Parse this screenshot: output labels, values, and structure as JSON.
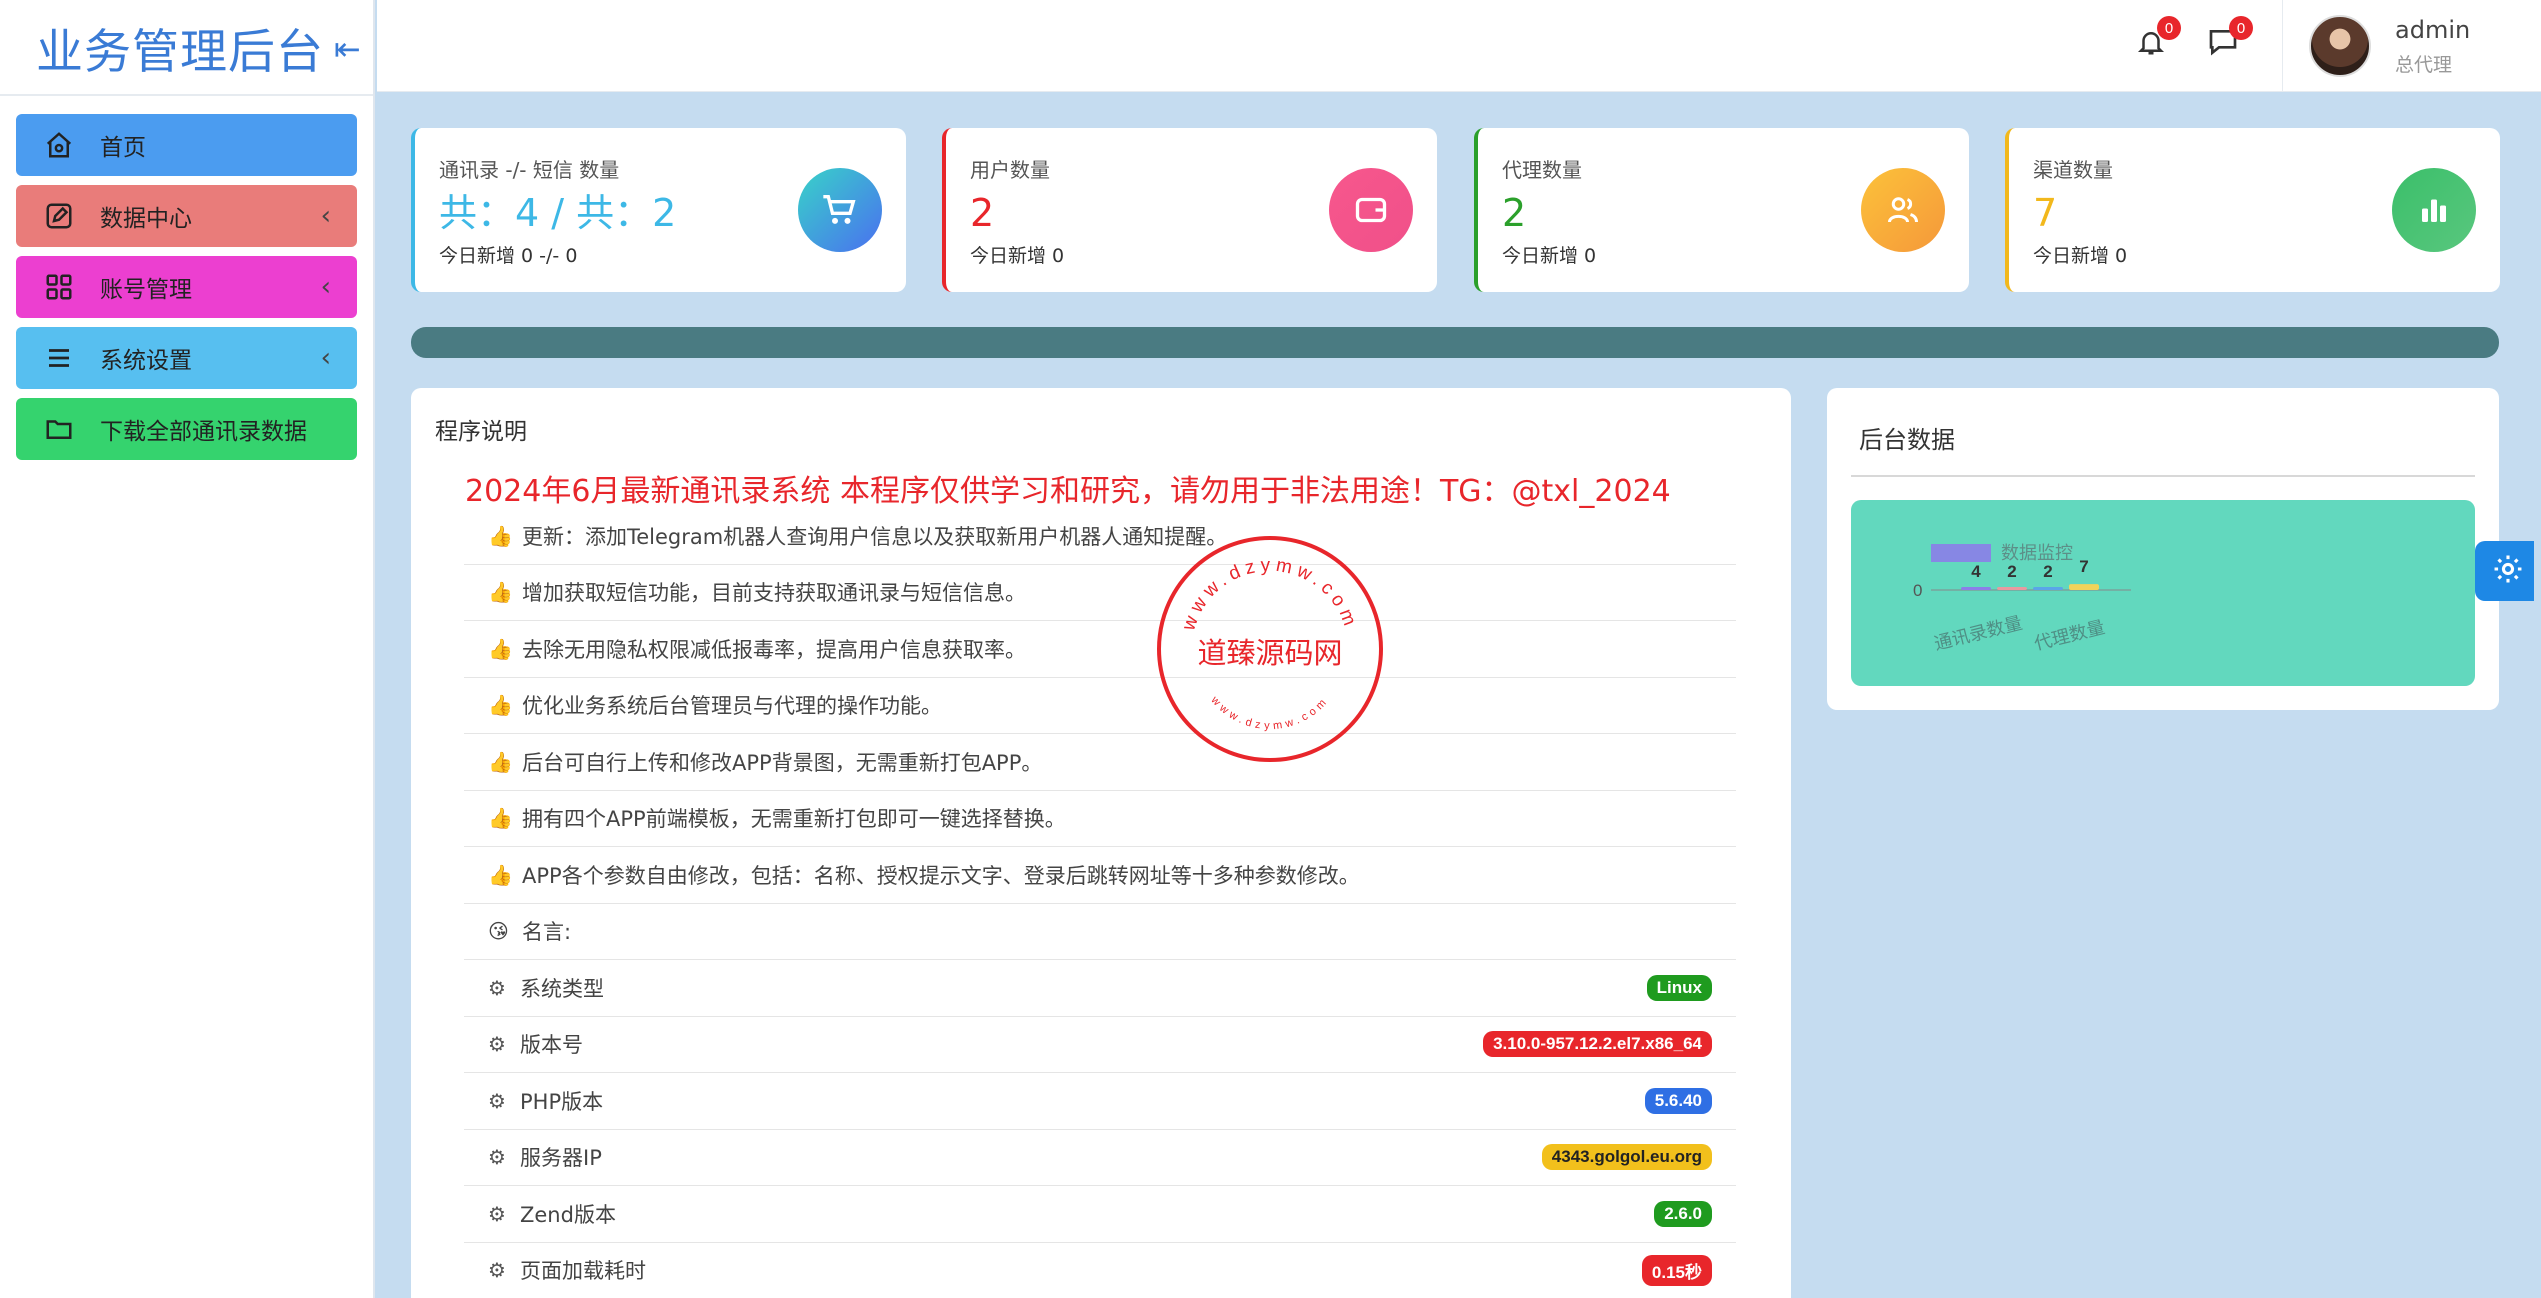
{
  "brand": {
    "title": "业务管理后台",
    "toggle": "⇤"
  },
  "menu": [
    {
      "label": "首页",
      "icon": "home-icon",
      "arrow": ""
    },
    {
      "label": "数据中心",
      "icon": "edit-icon",
      "arrow": "‹"
    },
    {
      "label": "账号管理",
      "icon": "grid-icon",
      "arrow": "‹"
    },
    {
      "label": "系统设置",
      "icon": "list-icon",
      "arrow": "‹"
    },
    {
      "label": "下载全部通讯录数据",
      "icon": "folder-icon",
      "arrow": ""
    }
  ],
  "header": {
    "notifications_count": "0",
    "messages_count": "0",
    "user_name": "admin",
    "user_role": "总代理"
  },
  "stats": [
    {
      "label": "通讯录 -/- 短信 数量",
      "value": "共：4 / 共：2",
      "sub": "今日新增 0 -/- 0",
      "color": "#3db8e6",
      "icon": "cart-icon"
    },
    {
      "label": "用户数量",
      "value": "2",
      "sub": "今日新增 0",
      "color": "#e8262b",
      "icon": "wallet-icon"
    },
    {
      "label": "代理数量",
      "value": "2",
      "sub": "今日新增 0",
      "color": "#2ba02b",
      "icon": "users-icon"
    },
    {
      "label": "渠道数量",
      "value": "7",
      "sub": "今日新增 0",
      "color": "#f2b81c",
      "icon": "bar-chart-icon"
    }
  ],
  "program": {
    "title": "程序说明",
    "warning": "2024年6月最新通讯录系统 本程序仅供学习和研究，请勿用于非法用途！TG：@txl_2024",
    "features": [
      "更新：添加Telegram机器人查询用户信息以及获取新用户机器人通知提醒。",
      "增加获取短信功能，目前支持获取通讯录与短信信息。",
      "去除无用隐私权限减低报毒率，提高用户信息获取率。",
      "优化业务系统后台管理员与代理的操作功能。",
      "后台可自行上传和修改APP背景图，无需重新打包APP。",
      "拥有四个APP前端模板，无需重新打包即可一键选择替换。",
      "APP各个参数自由修改，包括：名称、授权提示文字、登录后跳转网址等十多种参数修改。"
    ],
    "feature_emoji": "👍",
    "quote_label": "名言:",
    "quote_emoji": "😘",
    "system_info": [
      {
        "label": "系统类型",
        "value": "Linux",
        "color": "#1f9b1f"
      },
      {
        "label": "版本号",
        "value": "3.10.0-957.12.2.el7.x86_64",
        "color": "#e8262b"
      },
      {
        "label": "PHP版本",
        "value": "5.6.40",
        "color": "#2f6fe4"
      },
      {
        "label": "服务器IP",
        "value": "4343.golgol.eu.org",
        "color": "#f2c01c"
      },
      {
        "label": "Zend版本",
        "value": "2.6.0",
        "color": "#1f9b1f"
      },
      {
        "label": "页面加载耗时",
        "value": "0.15秒",
        "color": "#e8262b"
      }
    ]
  },
  "stamp": {
    "name": "道臻源码网",
    "url_top": "www.dzymw.com",
    "url_bottom": "www.dzymw.com"
  },
  "backend": {
    "title": "后台数据",
    "chart_data": {
      "type": "bar",
      "title": "数据监控",
      "categories": [
        "通讯录数量",
        "",
        "代理数量",
        ""
      ],
      "visible_category_labels": [
        "通讯录数量",
        "代理数量"
      ],
      "values": [
        4,
        2,
        2,
        7
      ],
      "colors": [
        "#8c7ee8",
        "#e89aa0",
        "#5aa5e8",
        "#f2d35a"
      ],
      "ytick": "0"
    }
  }
}
